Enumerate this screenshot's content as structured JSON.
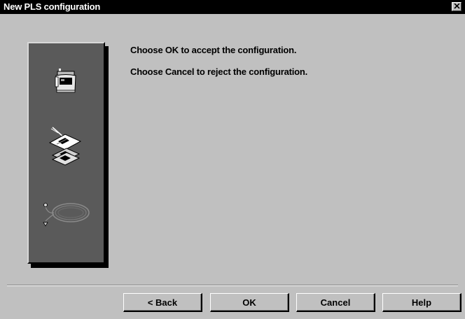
{
  "window": {
    "title": "New PLS configuration",
    "close_icon": "close-icon"
  },
  "side_panel": {
    "icons": [
      "scanner-device-icon",
      "configuration-sheet-icon",
      "cable-connection-icon"
    ]
  },
  "messages": {
    "line1": "Choose OK to accept the configuration.",
    "line2": "Choose Cancel to reject the configuration."
  },
  "buttons": {
    "back": "< Back",
    "ok": "OK",
    "cancel": "Cancel",
    "help": "Help"
  },
  "colors": {
    "title_bar": "#000000",
    "dialog_bg": "#c0c0c0",
    "panel_bg": "#5a5a5a"
  }
}
